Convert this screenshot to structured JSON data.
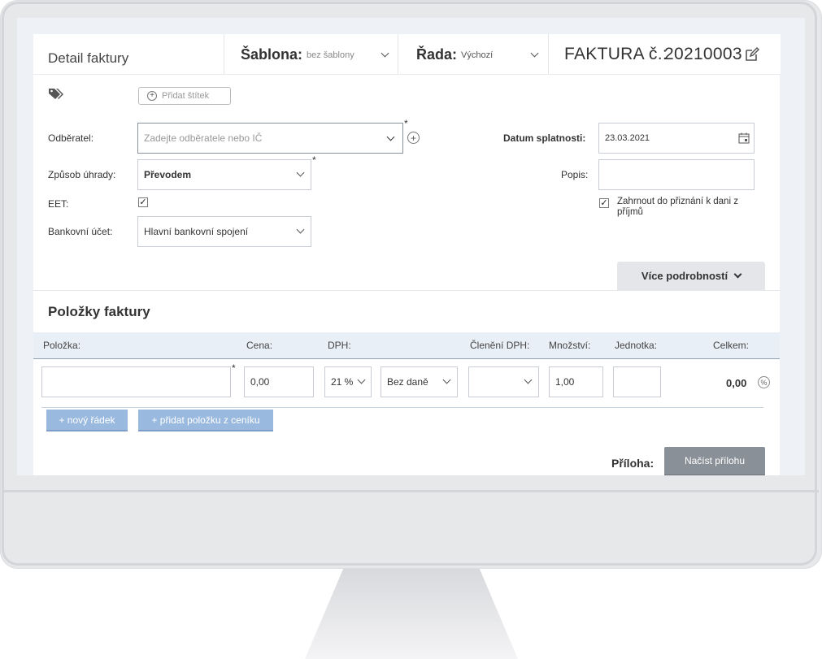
{
  "header": {
    "title": "Detail faktury",
    "template_label": "Šablona:",
    "template_value": "bez šablony",
    "series_label": "Řada:",
    "series_value": "Výchozí",
    "invoice_label": "FAKTURA č.:",
    "invoice_number": "20210003"
  },
  "tags": {
    "add_label": "Přidat štítek"
  },
  "form": {
    "customer_label": "Odběratel:",
    "customer_placeholder": "Zadejte odběratele nebo IČ",
    "payment_label": "Způsob úhrady:",
    "payment_value": "Převodem",
    "eet_label": "EET:",
    "eet_checked": true,
    "bank_label": "Bankovní účet:",
    "bank_value": "Hlavní bankovní spojení",
    "due_label": "Datum splatnosti:",
    "due_value": "23.03.2021",
    "desc_label": "Popis:",
    "desc_value": "",
    "include_tax_label": "Zahrnout do přiznání k dani z příjmů",
    "include_tax_checked": true,
    "required_mark": "*"
  },
  "more_details": "Více podrobností",
  "items": {
    "title": "Položky faktury",
    "columns": {
      "item": "Položka:",
      "price": "Cena:",
      "vat": "DPH:",
      "vat_split": "Členění DPH:",
      "quantity": "Množství:",
      "unit": "Jednotka:",
      "total": "Celkem:"
    },
    "row": {
      "item": "",
      "price": "0,00",
      "vat_rate": "21 %",
      "vat_mode": "Bez daně",
      "vat_split": "",
      "quantity": "1,00",
      "unit": "",
      "total": "0,00",
      "discount_icon": "%"
    },
    "new_row_button": "+ nový řádek",
    "from_pricelist_button": "+ přidat položku z ceníku"
  },
  "attachment": {
    "label": "Příloha:",
    "button": "Načíst přílohu"
  },
  "colors": {
    "accent_blue": "#9ab9de",
    "button_gray": "#8a9097",
    "table_header_bg": "#e9eff7"
  }
}
